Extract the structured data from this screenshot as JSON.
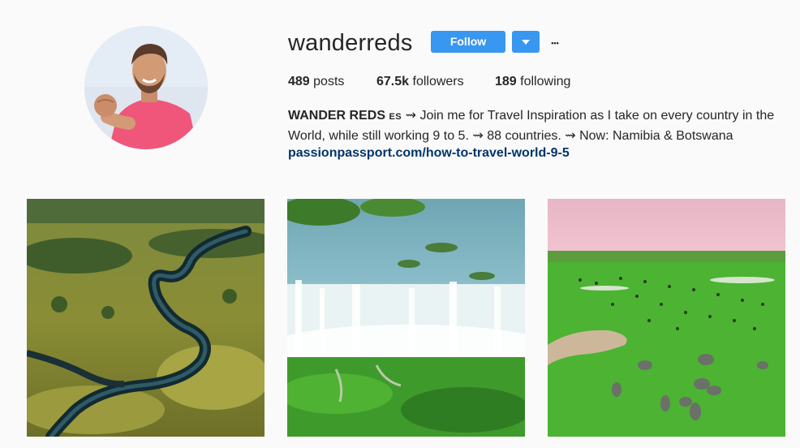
{
  "profile": {
    "username": "wanderreds",
    "follow_label": "Follow",
    "more_glyph": "•••"
  },
  "stats": {
    "posts_count": "489",
    "posts_label": "posts",
    "followers_count": "67.5k",
    "followers_label": "followers",
    "following_count": "189",
    "following_label": "following"
  },
  "bio": {
    "name": "WANDER REDS",
    "flag": "ES",
    "line1_text": "⇝ Join me for Travel Inspiration as I take on every country in the",
    "line2_text": "World, while still working 9 to 5. ⇝ 88 countries. ⇝ Now: Namibia & Botswana",
    "link": "passionpassport.com/how-to-travel-world-9-5"
  },
  "colors": {
    "accent": "#3897f0",
    "link": "#003569",
    "text": "#262626",
    "background": "#fafafa"
  },
  "posts": [
    {
      "subject": "aerial-river-delta"
    },
    {
      "subject": "aerial-waterfall"
    },
    {
      "subject": "aerial-elephant-herd"
    }
  ]
}
